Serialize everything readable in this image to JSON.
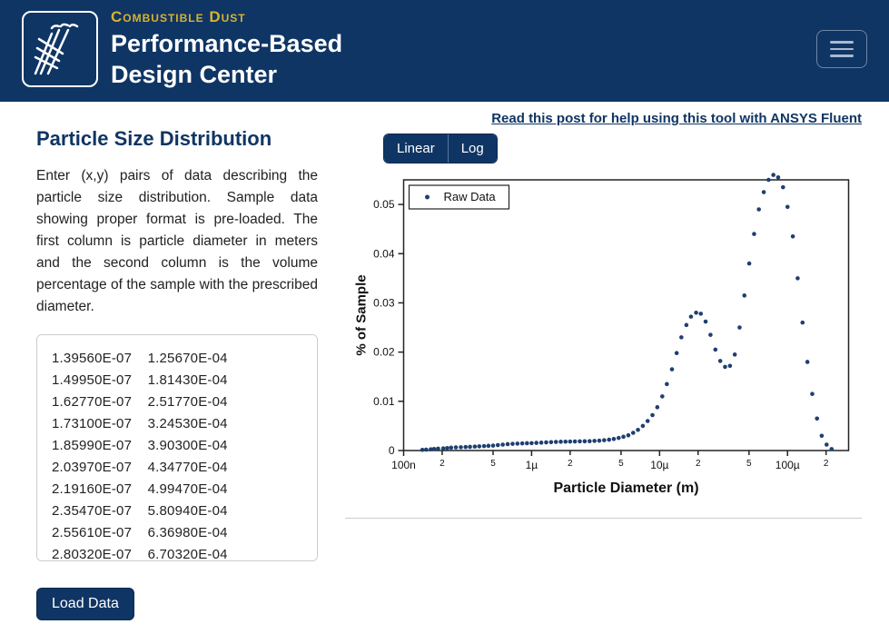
{
  "brand": {
    "top": "Combustible Dust",
    "line1": "Performance-Based",
    "line2": "Design Center"
  },
  "help_link": "Read this post for help using this tool with ANSYS Fluent",
  "left": {
    "title": "Particle Size Distribution",
    "description": "Enter (x,y) pairs of data describing the particle size distribution. Sample data showing proper format is pre-loaded. The first column is particle diameter in meters and the second column is the volume percentage of the sample with the prescribed diameter.",
    "load_button": "Load Data",
    "textarea_value": "1.39560E-07    1.25670E-04\n1.49950E-07    1.81430E-04\n1.62770E-07    2.51770E-04\n1.73100E-07    3.24530E-04\n1.85990E-07    3.90300E-04\n2.03970E-07    4.34770E-04\n2.19160E-07    4.99470E-04\n2.35470E-07    5.80940E-04\n2.55610E-07    6.36980E-04\n2.80320E-07    6.70320E-04"
  },
  "scale": {
    "linear": "Linear",
    "log": "Log"
  },
  "chart_data": {
    "type": "scatter",
    "title": "",
    "xlabel": "Particle Diameter (m)",
    "ylabel": "% of Sample",
    "legend": "Raw Data",
    "x_scale": "log",
    "x_range_m": [
      1e-07,
      0.0003
    ],
    "x_ticks_major": [
      {
        "value": 1e-07,
        "label": "100n"
      },
      {
        "value": 1e-06,
        "label": "1µ"
      },
      {
        "value": 1e-05,
        "label": "10µ"
      },
      {
        "value": 0.0001,
        "label": "100µ"
      }
    ],
    "x_ticks_minor": [
      2e-07,
      5e-07,
      2e-06,
      5e-06,
      2e-05,
      5e-05,
      0.0002
    ],
    "y_range": [
      0,
      0.055
    ],
    "y_ticks": [
      0,
      0.01,
      0.02,
      0.03,
      0.04,
      0.05
    ],
    "series": [
      {
        "name": "Raw Data",
        "data": [
          [
            1.4e-07,
            0.00013
          ],
          [
            1.5e-07,
            0.00018
          ],
          [
            1.63e-07,
            0.00025
          ],
          [
            1.73e-07,
            0.00032
          ],
          [
            1.86e-07,
            0.00039
          ],
          [
            2.04e-07,
            0.00043
          ],
          [
            2.19e-07,
            0.0005
          ],
          [
            2.35e-07,
            0.00058
          ],
          [
            2.56e-07,
            0.00064
          ],
          [
            2.8e-07,
            0.00067
          ],
          [
            3.05e-07,
            0.00071
          ],
          [
            3.3e-07,
            0.00075
          ],
          [
            3.6e-07,
            0.0008
          ],
          [
            3.9e-07,
            0.00085
          ],
          [
            4.25e-07,
            0.0009
          ],
          [
            4.6e-07,
            0.00095
          ],
          [
            5e-07,
            0.001
          ],
          [
            5.45e-07,
            0.0011
          ],
          [
            5.95e-07,
            0.0012
          ],
          [
            6.5e-07,
            0.0013
          ],
          [
            7.1e-07,
            0.00135
          ],
          [
            7.75e-07,
            0.0014
          ],
          [
            8.45e-07,
            0.00145
          ],
          [
            9.2e-07,
            0.00148
          ],
          [
            1e-06,
            0.0015
          ],
          [
            1.09e-06,
            0.00155
          ],
          [
            1.19e-06,
            0.0016
          ],
          [
            1.3e-06,
            0.00165
          ],
          [
            1.42e-06,
            0.0017
          ],
          [
            1.55e-06,
            0.00175
          ],
          [
            1.69e-06,
            0.00178
          ],
          [
            1.84e-06,
            0.0018
          ],
          [
            2e-06,
            0.00182
          ],
          [
            2.18e-06,
            0.00184
          ],
          [
            2.38e-06,
            0.00186
          ],
          [
            2.6e-06,
            0.00188
          ],
          [
            2.84e-06,
            0.0019
          ],
          [
            3.1e-06,
            0.00195
          ],
          [
            3.38e-06,
            0.002
          ],
          [
            3.69e-06,
            0.0021
          ],
          [
            4.03e-06,
            0.0022
          ],
          [
            4.39e-06,
            0.00235
          ],
          [
            4.79e-06,
            0.00255
          ],
          [
            5.22e-06,
            0.0028
          ],
          [
            5.7e-06,
            0.0031
          ],
          [
            6.22e-06,
            0.0036
          ],
          [
            6.78e-06,
            0.0042
          ],
          [
            7.4e-06,
            0.005
          ],
          [
            8.07e-06,
            0.006
          ],
          [
            8.8e-06,
            0.0072
          ],
          [
            9.6e-06,
            0.0088
          ],
          [
            1.05e-05,
            0.011
          ],
          [
            1.14e-05,
            0.0135
          ],
          [
            1.25e-05,
            0.0165
          ],
          [
            1.36e-05,
            0.0198
          ],
          [
            1.48e-05,
            0.023
          ],
          [
            1.62e-05,
            0.0255
          ],
          [
            1.76e-05,
            0.0272
          ],
          [
            1.93e-05,
            0.028
          ],
          [
            2.1e-05,
            0.0278
          ],
          [
            2.29e-05,
            0.0262
          ],
          [
            2.5e-05,
            0.0235
          ],
          [
            2.73e-05,
            0.0205
          ],
          [
            2.98e-05,
            0.0182
          ],
          [
            3.25e-05,
            0.017
          ],
          [
            3.55e-05,
            0.0172
          ],
          [
            3.87e-05,
            0.0195
          ],
          [
            4.22e-05,
            0.025
          ],
          [
            4.6e-05,
            0.0315
          ],
          [
            5.02e-05,
            0.038
          ],
          [
            5.48e-05,
            0.044
          ],
          [
            5.97e-05,
            0.049
          ],
          [
            6.52e-05,
            0.0525
          ],
          [
            7.11e-05,
            0.055
          ],
          [
            7.75e-05,
            0.056
          ],
          [
            8.45e-05,
            0.0555
          ],
          [
            9.22e-05,
            0.0535
          ],
          [
            0.0001,
            0.0495
          ],
          [
            0.00011,
            0.0435
          ],
          [
            0.00012,
            0.035
          ],
          [
            0.000131,
            0.026
          ],
          [
            0.000143,
            0.018
          ],
          [
            0.000156,
            0.0115
          ],
          [
            0.00017,
            0.0065
          ],
          [
            0.000185,
            0.003
          ],
          [
            0.000202,
            0.0012
          ],
          [
            0.000221,
            0.0003
          ]
        ]
      }
    ]
  }
}
